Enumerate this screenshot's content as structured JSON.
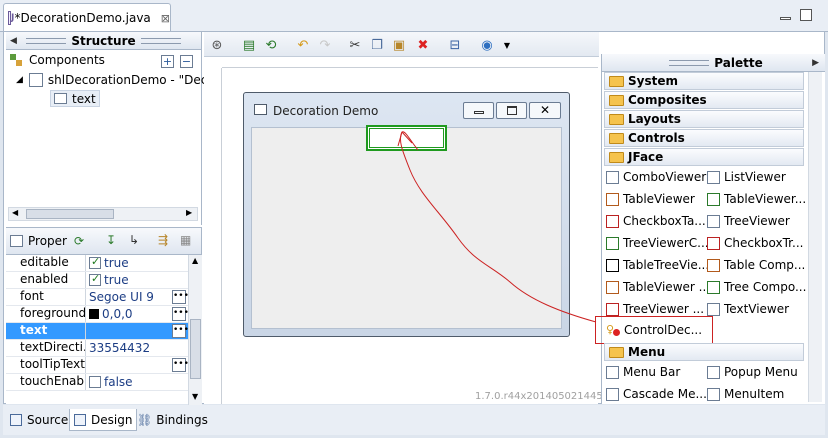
{
  "editor": {
    "tab_title": "*DecorationDemo.java",
    "close_glyph": "⊠"
  },
  "structure": {
    "title": "Structure",
    "components_label": "Components",
    "tree": [
      {
        "label": "shlDecorationDemo - \"Deco"
      },
      {
        "label": "text"
      }
    ]
  },
  "properties": {
    "title": "Proper",
    "rows": [
      {
        "name": "editable",
        "value": "true",
        "checkbox": true,
        "checked": true
      },
      {
        "name": "enabled",
        "value": "true",
        "checkbox": true,
        "checked": true
      },
      {
        "name": "font",
        "value": "Segoe UI 9",
        "dots": true
      },
      {
        "name": "foreground",
        "value": "0,0,0",
        "swatch": "#000000",
        "dots": true
      },
      {
        "name": "text",
        "value": "",
        "dots": true,
        "selected": true
      },
      {
        "name": "textDirecti...",
        "value": "33554432"
      },
      {
        "name": "toolTipText",
        "value": "",
        "dots": true
      },
      {
        "name": "touchEnab...",
        "value": "false",
        "checkbox": true,
        "checked": false
      }
    ]
  },
  "canvas": {
    "window_title": "Decoration Demo",
    "version": "1.7.0.r44x201405021445"
  },
  "palette": {
    "title": "Palette",
    "categories": [
      "System",
      "Composites",
      "Layouts",
      "Controls",
      "JFace",
      "Menu"
    ],
    "jface_items": [
      [
        "ComboViewer",
        "ListViewer"
      ],
      [
        "TableViewer",
        "TableViewer..."
      ],
      [
        "CheckboxTa...",
        "TreeViewer"
      ],
      [
        "TreeViewerC...",
        "CheckboxTr..."
      ],
      [
        "TableTreeVie...",
        "Table Comp..."
      ],
      [
        "TableViewer ...",
        "Tree Compo..."
      ],
      [
        "TreeViewer ...",
        "TextViewer"
      ],
      [
        "ControlDec...",
        ""
      ]
    ],
    "menu_items": [
      [
        "Menu Bar",
        "Popup Menu"
      ],
      [
        "Cascade Me...",
        "MenuItem"
      ]
    ]
  },
  "bottom_tabs": [
    "Source",
    "Design",
    "Bindings"
  ],
  "colors": {
    "selection": "#3399ff",
    "highlight_box": "#cc2222",
    "drag_line": "#cc2222",
    "text_widget_border": "#1f9a1f"
  }
}
